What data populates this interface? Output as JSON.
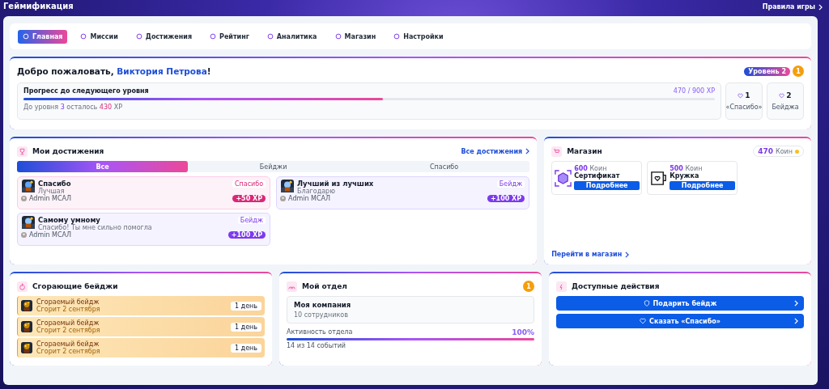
{
  "header": {
    "title": "Геймификация",
    "rules_link": "Правила игры"
  },
  "nav": [
    {
      "label": "Главная",
      "selected": true
    },
    {
      "label": "Миссии",
      "selected": false
    },
    {
      "label": "Достижения",
      "selected": false
    },
    {
      "label": "Рейтинг",
      "selected": false
    },
    {
      "label": "Аналитика",
      "selected": false
    },
    {
      "label": "Магазин",
      "selected": false
    },
    {
      "label": "Настройки",
      "selected": false
    }
  ],
  "welcome": {
    "greeting": "Добро пожаловать, ",
    "name": "Виктория Петрова",
    "exclaim": "!",
    "level_badge": "Уровень 2",
    "coin_badge": "1",
    "progress": {
      "title": "Прогресс до следующего уровня",
      "reading": "470 / 900 XP",
      "level": 0.52,
      "note": [
        {
          "text": "До уровня ",
          "kind": "plain"
        },
        {
          "text": "3",
          "kind": "level"
        },
        {
          "text": " осталось ",
          "kind": "plain"
        },
        {
          "text": "430",
          "kind": "xp"
        },
        {
          "text": " XP",
          "kind": "plain"
        }
      ]
    },
    "stats": [
      {
        "value": "1",
        "label": "«Спасибо»"
      },
      {
        "value": "2",
        "label": "Бейджа"
      }
    ]
  },
  "achievements": {
    "title": "Мои достижения",
    "all_link": "Все достижения",
    "tabs": [
      {
        "label": "Все",
        "selected": true
      },
      {
        "label": "Бейджи",
        "selected": false
      },
      {
        "label": "Спасибо",
        "selected": false
      }
    ],
    "items": [
      {
        "kind": "thanks",
        "title": "Спасибо",
        "subtitle": "Лучшая",
        "tag": "Спасибо",
        "author": "Admin МСАЛ",
        "xp": "+50 XP"
      },
      {
        "kind": "badge",
        "title": "Лучший из лучших",
        "subtitle": "Благодарю",
        "tag": "Бейдж",
        "author": "Admin МСАЛ",
        "xp": "+100 XP"
      },
      {
        "kind": "badge",
        "title": "Самому умному",
        "subtitle": "Спасибо! Ты мне сильно помогла",
        "tag": "Бейдж",
        "author": "Admin МСАЛ",
        "xp": "+100 XP"
      }
    ]
  },
  "shop": {
    "title": "Магазин",
    "balance": "470",
    "balance_unit": "Коин",
    "items": [
      {
        "kind": "certificate",
        "price": "600",
        "unit": "Коин",
        "name": "Сертификат",
        "button": "Подробнее"
      },
      {
        "kind": "mug",
        "price": "500",
        "unit": "Коин",
        "name": "Кружка",
        "button": "Подробнее"
      }
    ],
    "link": "Перейти в магазин"
  },
  "burning": {
    "title": "Сгорающие бейджи",
    "items": [
      {
        "name": "Сгораемый бейдж",
        "date": "Сгорит 2 сентября",
        "left": "1 день"
      },
      {
        "name": "Сгораемый бейдж",
        "date": "Сгорит 2 сентября",
        "left": "1 день"
      },
      {
        "name": "Сгораемый бейдж",
        "date": "Сгорит 2 сентября",
        "left": "1 день"
      }
    ]
  },
  "department": {
    "title": "Мой отдел",
    "badge": "1",
    "company": "Моя компания",
    "employees": "10 сотрудников",
    "activity_label": "Активность отдела",
    "activity_value": "100%",
    "level": 1,
    "events": "14 из 14 событий"
  },
  "actions": {
    "title": "Доступные действия",
    "buttons": [
      {
        "kind": "badge",
        "label": "Подарить бейдж"
      },
      {
        "kind": "thanks",
        "label": "Сказать «Спасибо»"
      }
    ]
  }
}
